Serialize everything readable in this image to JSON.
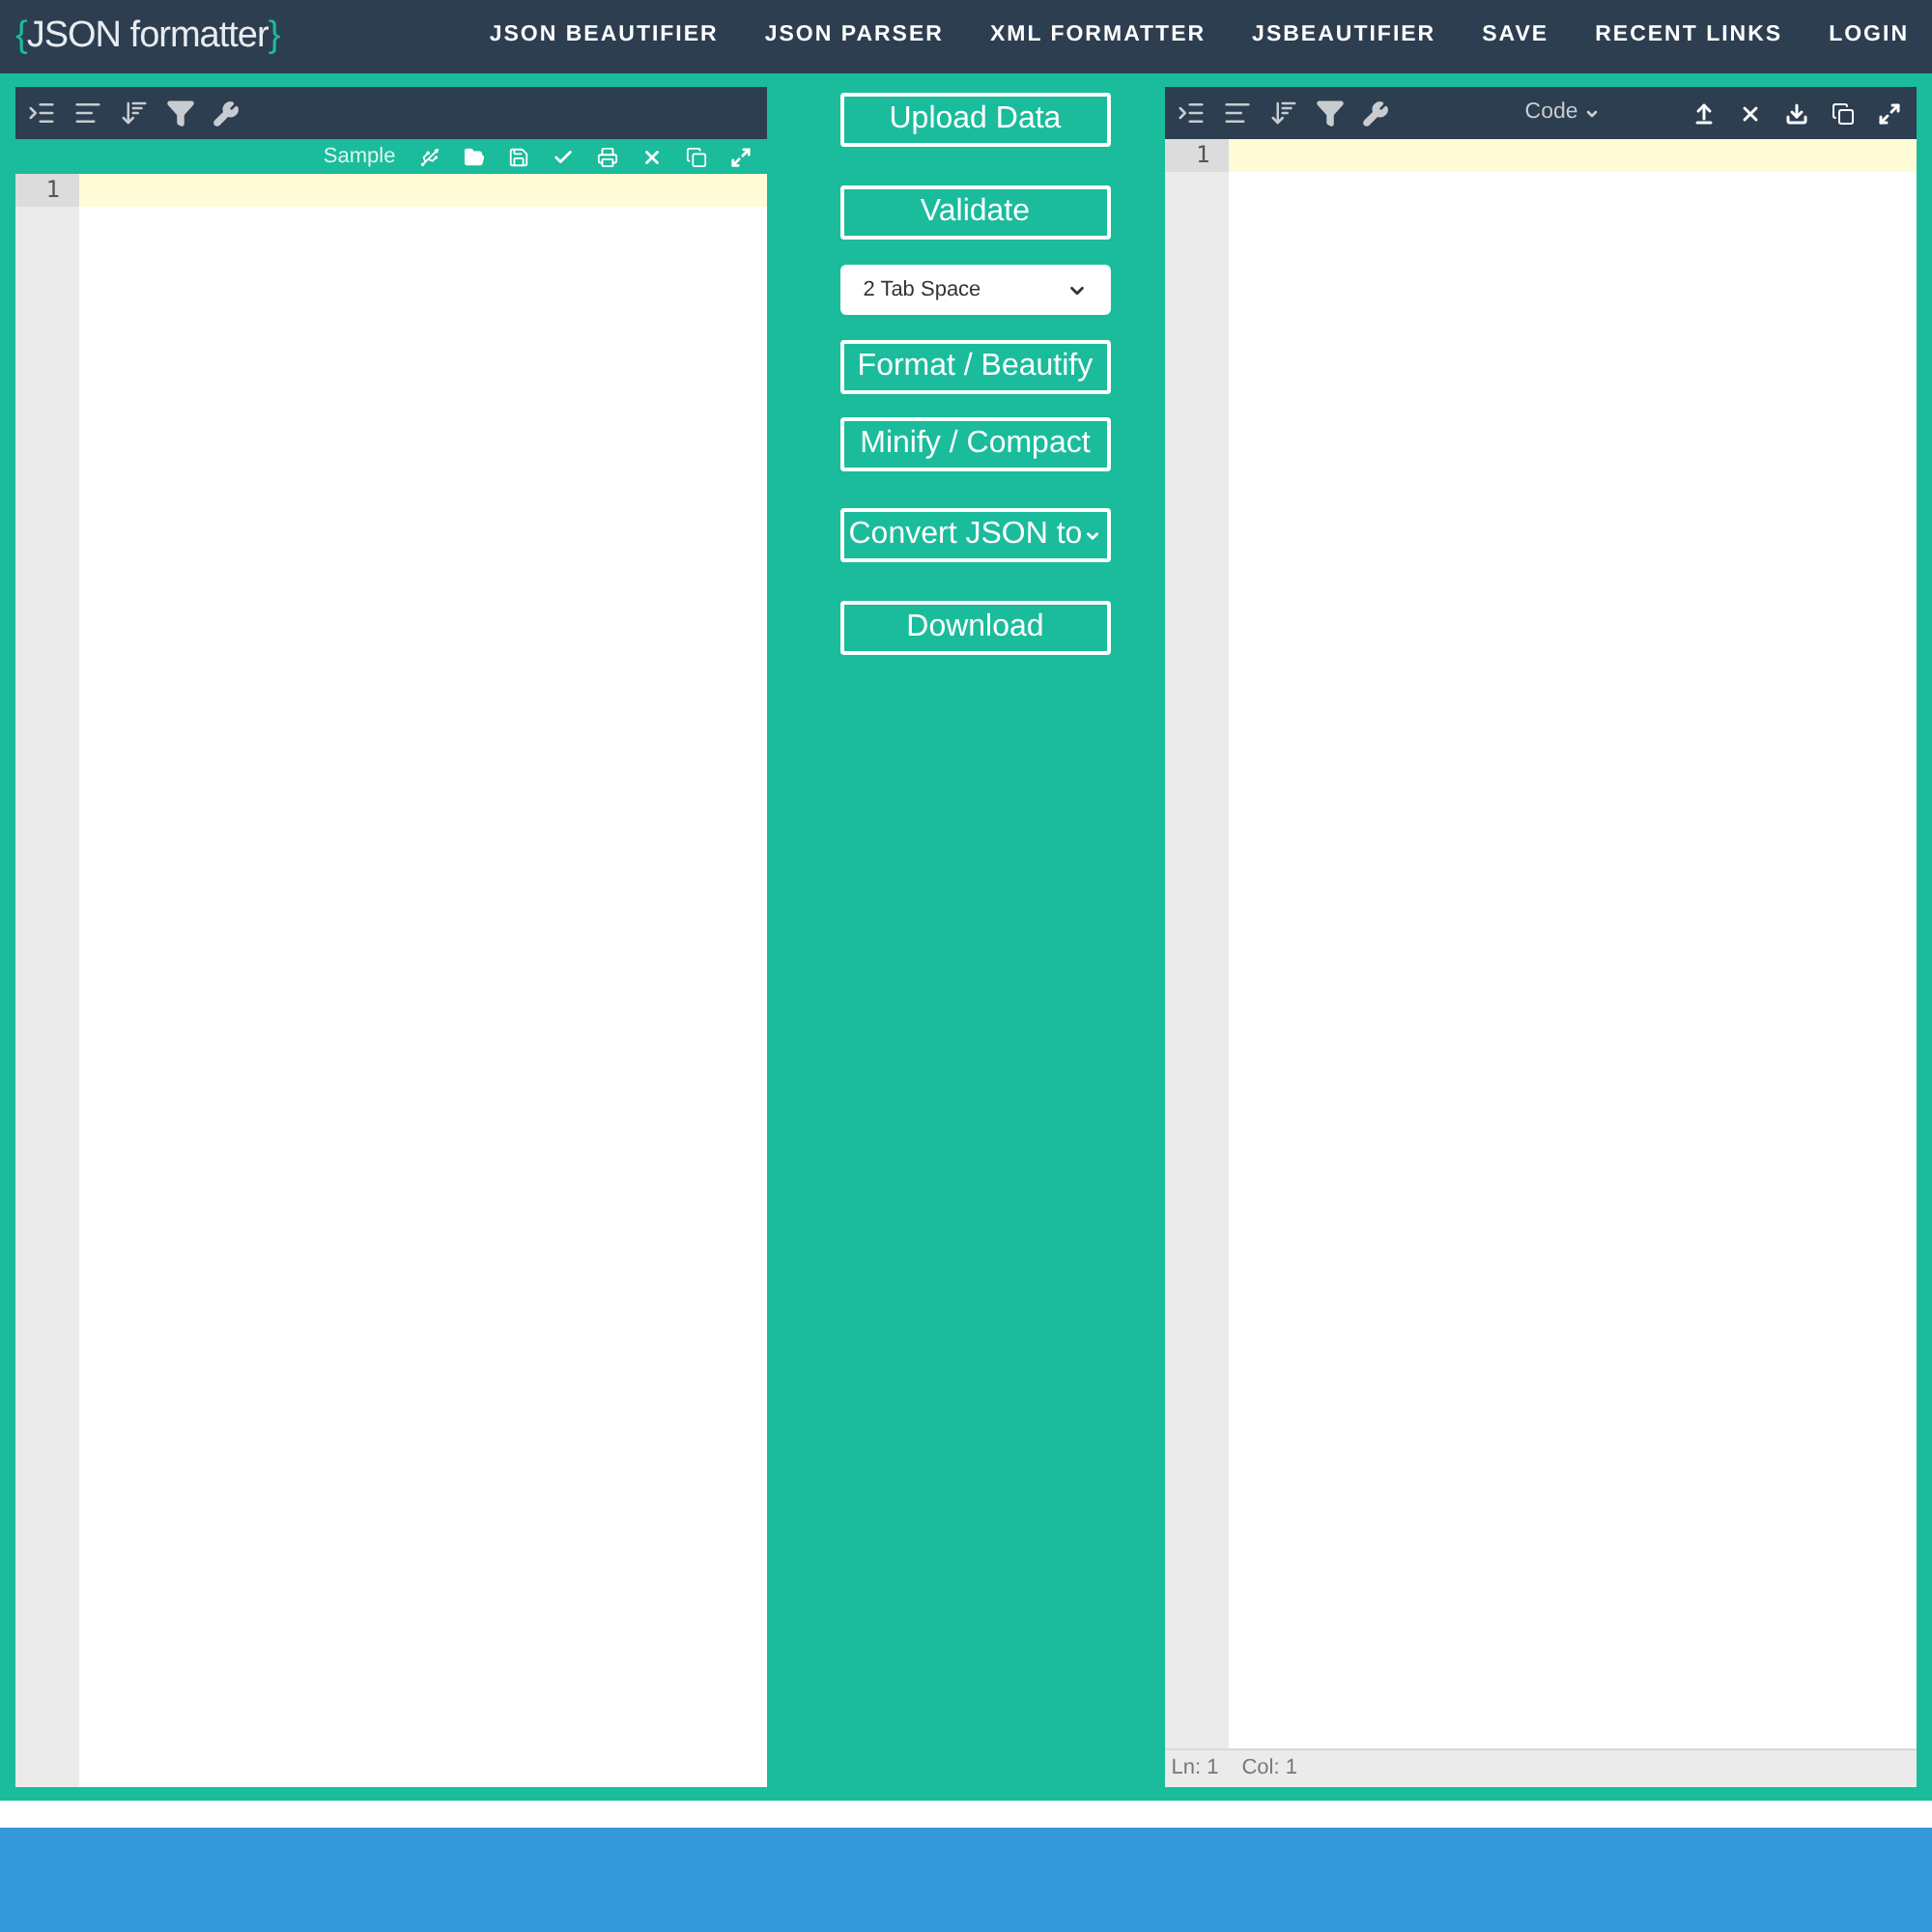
{
  "header": {
    "logo": {
      "open": "{",
      "text": "JSON formatter",
      "close": "}"
    },
    "nav": [
      "JSON BEAUTIFIER",
      "JSON PARSER",
      "XML FORMATTER",
      "JSBEAUTIFIER",
      "SAVE",
      "RECENT LINKS",
      "LOGIN"
    ]
  },
  "input_editor": {
    "sample_link": "Sample",
    "line_numbers": [
      "1"
    ]
  },
  "actions": [
    {
      "kind": "button",
      "label": "Upload Data"
    },
    {
      "kind": "button",
      "label": "Validate"
    },
    {
      "kind": "select",
      "value": "2 Tab Space"
    },
    {
      "kind": "button",
      "label": "Format / Beautify"
    },
    {
      "kind": "button",
      "label": "Minify / Compact"
    },
    {
      "kind": "dropdown",
      "label": "Convert JSON to"
    },
    {
      "kind": "button",
      "label": "Download"
    }
  ],
  "output_editor": {
    "mode": "Code",
    "line_numbers": [
      "1"
    ],
    "status_bar": {
      "line": "Ln: 1",
      "column": "Col: 1"
    }
  }
}
